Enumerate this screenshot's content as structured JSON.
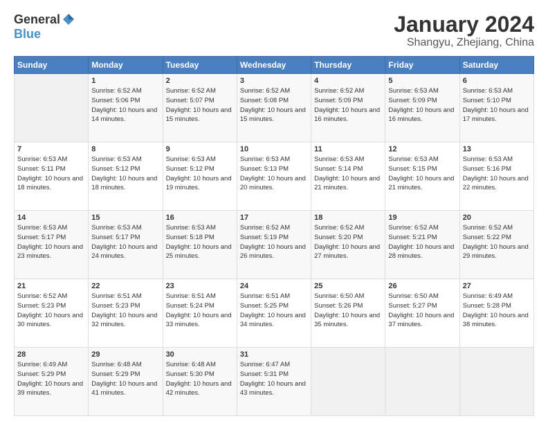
{
  "logo": {
    "general": "General",
    "blue": "Blue"
  },
  "header": {
    "title": "January 2024",
    "location": "Shangyu, Zhejiang, China"
  },
  "days_of_week": [
    "Sunday",
    "Monday",
    "Tuesday",
    "Wednesday",
    "Thursday",
    "Friday",
    "Saturday"
  ],
  "weeks": [
    [
      {
        "day": "",
        "sunrise": "",
        "sunset": "",
        "daylight": ""
      },
      {
        "day": "1",
        "sunrise": "Sunrise: 6:52 AM",
        "sunset": "Sunset: 5:06 PM",
        "daylight": "Daylight: 10 hours and 14 minutes."
      },
      {
        "day": "2",
        "sunrise": "Sunrise: 6:52 AM",
        "sunset": "Sunset: 5:07 PM",
        "daylight": "Daylight: 10 hours and 15 minutes."
      },
      {
        "day": "3",
        "sunrise": "Sunrise: 6:52 AM",
        "sunset": "Sunset: 5:08 PM",
        "daylight": "Daylight: 10 hours and 15 minutes."
      },
      {
        "day": "4",
        "sunrise": "Sunrise: 6:52 AM",
        "sunset": "Sunset: 5:09 PM",
        "daylight": "Daylight: 10 hours and 16 minutes."
      },
      {
        "day": "5",
        "sunrise": "Sunrise: 6:53 AM",
        "sunset": "Sunset: 5:09 PM",
        "daylight": "Daylight: 10 hours and 16 minutes."
      },
      {
        "day": "6",
        "sunrise": "Sunrise: 6:53 AM",
        "sunset": "Sunset: 5:10 PM",
        "daylight": "Daylight: 10 hours and 17 minutes."
      }
    ],
    [
      {
        "day": "7",
        "sunrise": "Sunrise: 6:53 AM",
        "sunset": "Sunset: 5:11 PM",
        "daylight": "Daylight: 10 hours and 18 minutes."
      },
      {
        "day": "8",
        "sunrise": "Sunrise: 6:53 AM",
        "sunset": "Sunset: 5:12 PM",
        "daylight": "Daylight: 10 hours and 18 minutes."
      },
      {
        "day": "9",
        "sunrise": "Sunrise: 6:53 AM",
        "sunset": "Sunset: 5:12 PM",
        "daylight": "Daylight: 10 hours and 19 minutes."
      },
      {
        "day": "10",
        "sunrise": "Sunrise: 6:53 AM",
        "sunset": "Sunset: 5:13 PM",
        "daylight": "Daylight: 10 hours and 20 minutes."
      },
      {
        "day": "11",
        "sunrise": "Sunrise: 6:53 AM",
        "sunset": "Sunset: 5:14 PM",
        "daylight": "Daylight: 10 hours and 21 minutes."
      },
      {
        "day": "12",
        "sunrise": "Sunrise: 6:53 AM",
        "sunset": "Sunset: 5:15 PM",
        "daylight": "Daylight: 10 hours and 21 minutes."
      },
      {
        "day": "13",
        "sunrise": "Sunrise: 6:53 AM",
        "sunset": "Sunset: 5:16 PM",
        "daylight": "Daylight: 10 hours and 22 minutes."
      }
    ],
    [
      {
        "day": "14",
        "sunrise": "Sunrise: 6:53 AM",
        "sunset": "Sunset: 5:17 PM",
        "daylight": "Daylight: 10 hours and 23 minutes."
      },
      {
        "day": "15",
        "sunrise": "Sunrise: 6:53 AM",
        "sunset": "Sunset: 5:17 PM",
        "daylight": "Daylight: 10 hours and 24 minutes."
      },
      {
        "day": "16",
        "sunrise": "Sunrise: 6:53 AM",
        "sunset": "Sunset: 5:18 PM",
        "daylight": "Daylight: 10 hours and 25 minutes."
      },
      {
        "day": "17",
        "sunrise": "Sunrise: 6:52 AM",
        "sunset": "Sunset: 5:19 PM",
        "daylight": "Daylight: 10 hours and 26 minutes."
      },
      {
        "day": "18",
        "sunrise": "Sunrise: 6:52 AM",
        "sunset": "Sunset: 5:20 PM",
        "daylight": "Daylight: 10 hours and 27 minutes."
      },
      {
        "day": "19",
        "sunrise": "Sunrise: 6:52 AM",
        "sunset": "Sunset: 5:21 PM",
        "daylight": "Daylight: 10 hours and 28 minutes."
      },
      {
        "day": "20",
        "sunrise": "Sunrise: 6:52 AM",
        "sunset": "Sunset: 5:22 PM",
        "daylight": "Daylight: 10 hours and 29 minutes."
      }
    ],
    [
      {
        "day": "21",
        "sunrise": "Sunrise: 6:52 AM",
        "sunset": "Sunset: 5:23 PM",
        "daylight": "Daylight: 10 hours and 30 minutes."
      },
      {
        "day": "22",
        "sunrise": "Sunrise: 6:51 AM",
        "sunset": "Sunset: 5:23 PM",
        "daylight": "Daylight: 10 hours and 32 minutes."
      },
      {
        "day": "23",
        "sunrise": "Sunrise: 6:51 AM",
        "sunset": "Sunset: 5:24 PM",
        "daylight": "Daylight: 10 hours and 33 minutes."
      },
      {
        "day": "24",
        "sunrise": "Sunrise: 6:51 AM",
        "sunset": "Sunset: 5:25 PM",
        "daylight": "Daylight: 10 hours and 34 minutes."
      },
      {
        "day": "25",
        "sunrise": "Sunrise: 6:50 AM",
        "sunset": "Sunset: 5:26 PM",
        "daylight": "Daylight: 10 hours and 35 minutes."
      },
      {
        "day": "26",
        "sunrise": "Sunrise: 6:50 AM",
        "sunset": "Sunset: 5:27 PM",
        "daylight": "Daylight: 10 hours and 37 minutes."
      },
      {
        "day": "27",
        "sunrise": "Sunrise: 6:49 AM",
        "sunset": "Sunset: 5:28 PM",
        "daylight": "Daylight: 10 hours and 38 minutes."
      }
    ],
    [
      {
        "day": "28",
        "sunrise": "Sunrise: 6:49 AM",
        "sunset": "Sunset: 5:29 PM",
        "daylight": "Daylight: 10 hours and 39 minutes."
      },
      {
        "day": "29",
        "sunrise": "Sunrise: 6:48 AM",
        "sunset": "Sunset: 5:29 PM",
        "daylight": "Daylight: 10 hours and 41 minutes."
      },
      {
        "day": "30",
        "sunrise": "Sunrise: 6:48 AM",
        "sunset": "Sunset: 5:30 PM",
        "daylight": "Daylight: 10 hours and 42 minutes."
      },
      {
        "day": "31",
        "sunrise": "Sunrise: 6:47 AM",
        "sunset": "Sunset: 5:31 PM",
        "daylight": "Daylight: 10 hours and 43 minutes."
      },
      {
        "day": "",
        "sunrise": "",
        "sunset": "",
        "daylight": ""
      },
      {
        "day": "",
        "sunrise": "",
        "sunset": "",
        "daylight": ""
      },
      {
        "day": "",
        "sunrise": "",
        "sunset": "",
        "daylight": ""
      }
    ]
  ]
}
